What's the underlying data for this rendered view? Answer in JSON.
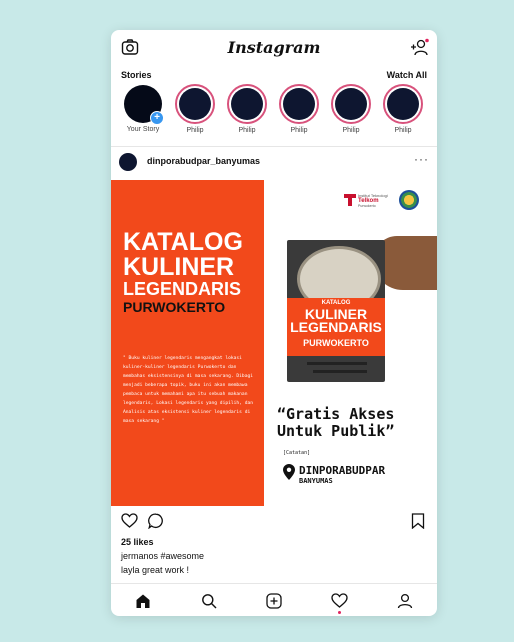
{
  "app": {
    "title": "Instagram"
  },
  "icons": {
    "camera": "camera-icon",
    "add_user": "add-user-icon",
    "more": "more-options-icon",
    "heart": "heart-icon",
    "comment": "comment-icon",
    "bookmark": "bookmark-icon",
    "home": "home-icon",
    "search": "search-icon",
    "new_post": "add-post-icon",
    "activity": "activity-heart-icon",
    "profile": "profile-icon"
  },
  "colors": {
    "background": "#c8e9e8",
    "story_ring": "#d8527c",
    "notification_dot": "#e0245e",
    "poster_orange": "#f2491b",
    "add_story_blue": "#3897f0"
  },
  "stories": {
    "heading": "Stories",
    "watch_all": "Watch All",
    "items": [
      {
        "name": "Your Story",
        "own": true
      },
      {
        "name": "Philip"
      },
      {
        "name": "Philip"
      },
      {
        "name": "Philip"
      },
      {
        "name": "Philip"
      },
      {
        "name": "Philip"
      }
    ]
  },
  "post": {
    "username": "dinporabudpar_banyumas",
    "more": "···",
    "image": {
      "title_lines": [
        "KATALOG",
        "KULINER",
        "LEGENDARIS",
        "PURWOKERTO"
      ],
      "description": "\" Buku kuliner legendaris mengangkat lokasi kuliner-kuliner legendaris Purwokerto dan membahas eksistensinya di masa sekarang. Dibagi menjadi beberapa topik, buku ini akan membawa pembaca untuk memahami apa itu sebuah makanan legendaris, Lokasi legendaris yang dipilih, dan Analisis atas eksistensi kuliner legendaris di masa sekarang \"",
      "sponsor_top": "Institut Teknologi",
      "sponsor_name": "Telkom",
      "sponsor_bottom": "Purwokerto",
      "book_line1": "KATALOG",
      "book_line2": "KULINER LEGENDARIS",
      "book_line3": "PURWOKERTO",
      "quote": "“Gratis Akses Untuk Publik”",
      "caption": "[Catatan]",
      "location_line1": "DINPORABUDPAR",
      "location_line2": "BANYUMAS"
    },
    "likes": "25 likes",
    "comments": [
      {
        "user": "jermanos",
        "text": "#awesome"
      },
      {
        "user": "layla",
        "text": "great work !"
      }
    ]
  }
}
